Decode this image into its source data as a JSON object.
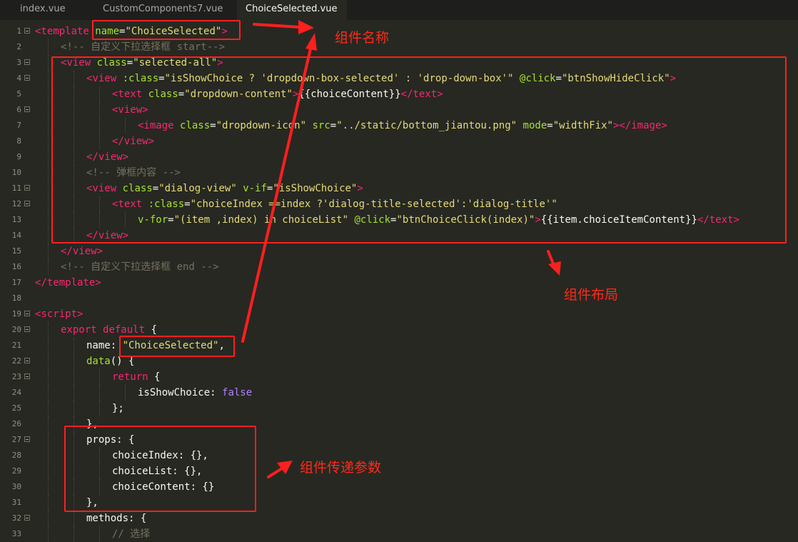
{
  "tabs": [
    {
      "label": "index.vue",
      "active": false
    },
    {
      "label": "CustomComponents7.vue",
      "active": false
    },
    {
      "label": "ChoiceSelected.vue",
      "active": true
    }
  ],
  "code_lines": [
    {
      "n": "1",
      "fold": true,
      "indent": 0,
      "tokens": [
        [
          "t",
          "<template"
        ],
        [
          "p",
          " "
        ],
        [
          "a",
          "name"
        ],
        [
          "p",
          "="
        ],
        [
          "s",
          "\"ChoiceSelected\""
        ],
        [
          "t",
          ">"
        ]
      ]
    },
    {
      "n": "2",
      "fold": false,
      "indent": 1,
      "tokens": [
        [
          "c",
          "<!-- 自定义下拉选择框 start-->"
        ]
      ]
    },
    {
      "n": "3",
      "fold": true,
      "indent": 1,
      "tokens": [
        [
          "t",
          "<view"
        ],
        [
          "p",
          " "
        ],
        [
          "a",
          "class"
        ],
        [
          "p",
          "="
        ],
        [
          "s",
          "\"selected-all\""
        ],
        [
          "t",
          ">"
        ]
      ]
    },
    {
      "n": "4",
      "fold": true,
      "indent": 2,
      "tokens": [
        [
          "t",
          "<view"
        ],
        [
          "p",
          " "
        ],
        [
          "a",
          ":class"
        ],
        [
          "p",
          "="
        ],
        [
          "s",
          "\"isShowChoice ? 'dropdown-box-selected' : 'drop-down-box'\""
        ],
        [
          "p",
          " "
        ],
        [
          "a",
          "@click"
        ],
        [
          "p",
          "="
        ],
        [
          "s",
          "\"btnShowHideClick\""
        ],
        [
          "t",
          ">"
        ]
      ]
    },
    {
      "n": "5",
      "fold": false,
      "indent": 3,
      "tokens": [
        [
          "t",
          "<text"
        ],
        [
          "p",
          " "
        ],
        [
          "a",
          "class"
        ],
        [
          "p",
          "="
        ],
        [
          "s",
          "\"dropdown-content\""
        ],
        [
          "t",
          ">"
        ],
        [
          "p",
          "{{choiceContent}}"
        ],
        [
          "t",
          "</text>"
        ]
      ]
    },
    {
      "n": "6",
      "fold": true,
      "indent": 3,
      "tokens": [
        [
          "t",
          "<view>"
        ]
      ]
    },
    {
      "n": "7",
      "fold": false,
      "indent": 4,
      "tokens": [
        [
          "t",
          "<image"
        ],
        [
          "p",
          " "
        ],
        [
          "a",
          "class"
        ],
        [
          "p",
          "="
        ],
        [
          "s",
          "\"dropdown-icon\""
        ],
        [
          "p",
          " "
        ],
        [
          "a",
          "src"
        ],
        [
          "p",
          "="
        ],
        [
          "s",
          "\"../static/bottom_jiantou.png\""
        ],
        [
          "p",
          " "
        ],
        [
          "a",
          "mode"
        ],
        [
          "p",
          "="
        ],
        [
          "s",
          "\"widthFix\""
        ],
        [
          "t",
          "></image>"
        ]
      ]
    },
    {
      "n": "8",
      "fold": false,
      "indent": 3,
      "tokens": [
        [
          "t",
          "</view>"
        ]
      ]
    },
    {
      "n": "9",
      "fold": false,
      "indent": 2,
      "tokens": [
        [
          "t",
          "</view>"
        ]
      ]
    },
    {
      "n": "10",
      "fold": false,
      "indent": 2,
      "tokens": [
        [
          "c",
          "<!-- 弹框内容 -->"
        ]
      ]
    },
    {
      "n": "11",
      "fold": true,
      "indent": 2,
      "tokens": [
        [
          "t",
          "<view"
        ],
        [
          "p",
          " "
        ],
        [
          "a",
          "class"
        ],
        [
          "p",
          "="
        ],
        [
          "s",
          "\"dialog-view\""
        ],
        [
          "p",
          " "
        ],
        [
          "a",
          "v-if"
        ],
        [
          "p",
          "="
        ],
        [
          "s",
          "\"isShowChoice\""
        ],
        [
          "t",
          ">"
        ]
      ]
    },
    {
      "n": "12",
      "fold": true,
      "indent": 3,
      "tokens": [
        [
          "t",
          "<text"
        ],
        [
          "p",
          " "
        ],
        [
          "a",
          ":class"
        ],
        [
          "p",
          "="
        ],
        [
          "s",
          "\"choiceIndex ==index ?'dialog-title-selected':'dialog-title'\""
        ]
      ]
    },
    {
      "n": "13",
      "fold": false,
      "indent": 4,
      "tokens": [
        [
          "a",
          "v-for"
        ],
        [
          "p",
          "="
        ],
        [
          "s",
          "\"(item ,index) in choiceList\""
        ],
        [
          "p",
          " "
        ],
        [
          "a",
          "@click"
        ],
        [
          "p",
          "="
        ],
        [
          "s",
          "\"btnChoiceClick(index)\""
        ],
        [
          "t",
          ">"
        ],
        [
          "p",
          "{{item.choiceItemContent}}"
        ],
        [
          "t",
          "</text>"
        ]
      ]
    },
    {
      "n": "14",
      "fold": false,
      "indent": 2,
      "tokens": [
        [
          "t",
          "</view>"
        ]
      ]
    },
    {
      "n": "15",
      "fold": false,
      "indent": 1,
      "tokens": [
        [
          "t",
          "</view>"
        ]
      ]
    },
    {
      "n": "16",
      "fold": false,
      "indent": 1,
      "tokens": [
        [
          "c",
          "<!-- 自定义下拉选择框 end -->"
        ]
      ]
    },
    {
      "n": "17",
      "fold": false,
      "indent": 0,
      "tokens": [
        [
          "t",
          "</template>"
        ]
      ]
    },
    {
      "n": "18",
      "fold": false,
      "indent": 0,
      "tokens": []
    },
    {
      "n": "19",
      "fold": true,
      "indent": 0,
      "tokens": [
        [
          "t",
          "<script>"
        ]
      ]
    },
    {
      "n": "20",
      "fold": true,
      "indent": 1,
      "tokens": [
        [
          "t",
          "export"
        ],
        [
          "p",
          " "
        ],
        [
          "t",
          "default"
        ],
        [
          "p",
          " {"
        ]
      ]
    },
    {
      "n": "21",
      "fold": false,
      "indent": 2,
      "tokens": [
        [
          "p",
          "name: "
        ],
        [
          "s",
          "\"ChoiceSelected\""
        ],
        [
          "p",
          ","
        ]
      ]
    },
    {
      "n": "22",
      "fold": true,
      "indent": 2,
      "tokens": [
        [
          "a",
          "data"
        ],
        [
          "p",
          "() {"
        ]
      ]
    },
    {
      "n": "23",
      "fold": true,
      "indent": 3,
      "tokens": [
        [
          "t",
          "return"
        ],
        [
          "p",
          " {"
        ]
      ]
    },
    {
      "n": "24",
      "fold": false,
      "indent": 4,
      "tokens": [
        [
          "p",
          "isShowChoice: "
        ],
        [
          "b",
          "false"
        ]
      ]
    },
    {
      "n": "25",
      "fold": false,
      "indent": 3,
      "tokens": [
        [
          "p",
          "};"
        ]
      ]
    },
    {
      "n": "26",
      "fold": false,
      "indent": 2,
      "tokens": [
        [
          "p",
          "},"
        ]
      ]
    },
    {
      "n": "27",
      "fold": true,
      "indent": 2,
      "tokens": [
        [
          "p",
          "props: {"
        ]
      ]
    },
    {
      "n": "28",
      "fold": false,
      "indent": 3,
      "tokens": [
        [
          "p",
          "choiceIndex: {},"
        ]
      ]
    },
    {
      "n": "29",
      "fold": false,
      "indent": 3,
      "tokens": [
        [
          "p",
          "choiceList: {},"
        ]
      ]
    },
    {
      "n": "30",
      "fold": false,
      "indent": 3,
      "tokens": [
        [
          "p",
          "choiceContent: {}"
        ]
      ]
    },
    {
      "n": "31",
      "fold": false,
      "indent": 2,
      "tokens": [
        [
          "p",
          "},"
        ]
      ]
    },
    {
      "n": "32",
      "fold": true,
      "indent": 2,
      "tokens": [
        [
          "p",
          "methods: {"
        ]
      ]
    },
    {
      "n": "33",
      "fold": false,
      "indent": 3,
      "tokens": [
        [
          "c",
          "// 选择"
        ]
      ]
    }
  ],
  "annotations": {
    "component_name": "组件名称",
    "component_layout": "组件布局",
    "component_params": "组件传递参数"
  },
  "colors": {
    "background": "#272822",
    "tag": "#f92672",
    "attribute": "#a6e22e",
    "string": "#e6db74",
    "comment": "#75715e",
    "annotation": "#ff1f1f"
  }
}
